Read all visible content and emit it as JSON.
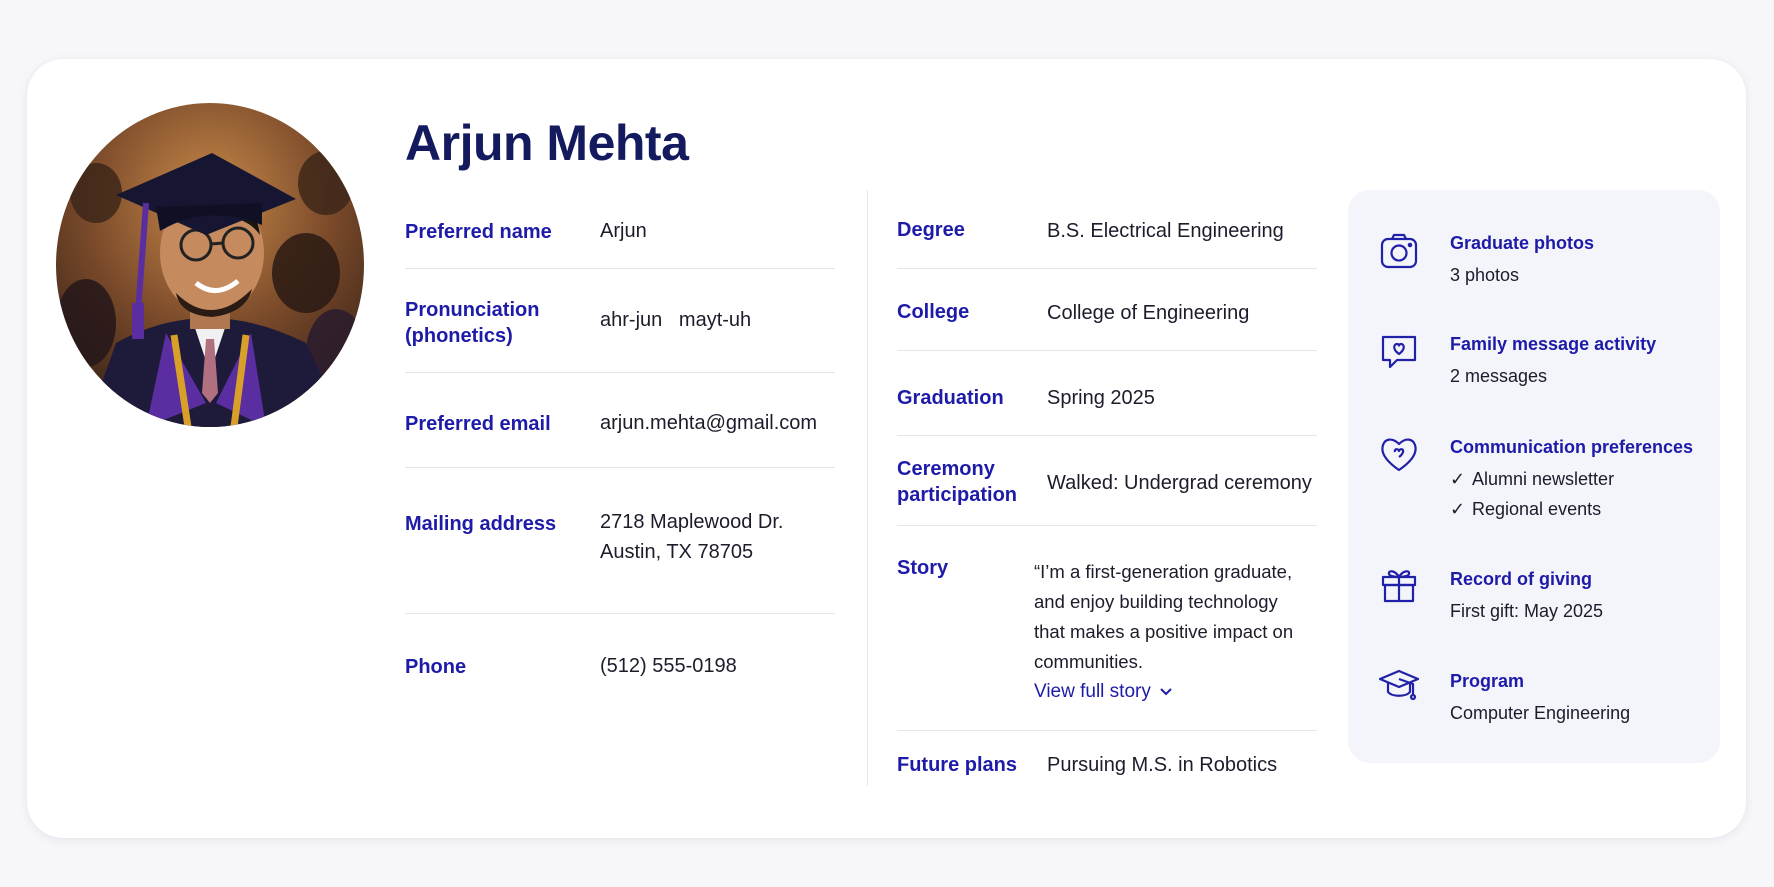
{
  "profile": {
    "name": "Arjun Mehta"
  },
  "personal": {
    "preferred_name_label": "Preferred name",
    "preferred_name_value": "Arjun",
    "pronunciation_label_1": "Pronunciation",
    "pronunciation_label_2": "(phonetics)",
    "pronunciation_value": "ahr-jun   mayt-uh",
    "email_label": "Preferred email",
    "email_value": "arjun.mehta@gmail.com",
    "address_label": "Mailing address",
    "address_line1": "2718 Maplewood Dr.",
    "address_line2": "Austin, TX 78705",
    "phone_label": "Phone",
    "phone_value": "(512) 555-0198"
  },
  "academic": {
    "degree_label": "Degree",
    "degree_value": "B.S. Electrical Engineering",
    "college_label": "College",
    "college_value": "College of Engineering",
    "graduation_label": "Graduation",
    "graduation_value": "Spring 2025",
    "ceremony_label_1": "Ceremony",
    "ceremony_label_2": "participation",
    "ceremony_value": "Walked: Undergrad ceremony",
    "story_label": "Story",
    "story_line1": "“I’m a first-generation graduate,",
    "story_line2": "and enjoy building technology",
    "story_line3": "that makes a positive impact on",
    "story_line4": "communities.",
    "story_link": "View full story",
    "future_label": "Future plans",
    "future_value": "Pursuing M.S. in Robotics"
  },
  "panel": {
    "photos_title": "Graduate photos",
    "photos_sub": "3 photos",
    "messages_title": "Family message activity",
    "messages_sub": "2 messages",
    "comm_title": "Communication preferences",
    "comm_item1": "Alumni newsletter",
    "comm_item2": "Regional events",
    "giving_title": "Record of giving",
    "giving_sub": "First gift: May 2025",
    "program_title": "Program",
    "program_sub": "Computer Engineering"
  },
  "icons": {
    "photos": "camera-icon",
    "messages": "chat-heart-icon",
    "comm": "heart-icon",
    "giving": "gift-icon",
    "program": "graduation-cap-icon",
    "story_chevron": "chevron-down-icon"
  },
  "colors": {
    "accent": "#1d1ba8",
    "name": "#141a5e",
    "panel_bg": "#f4f4fb"
  }
}
